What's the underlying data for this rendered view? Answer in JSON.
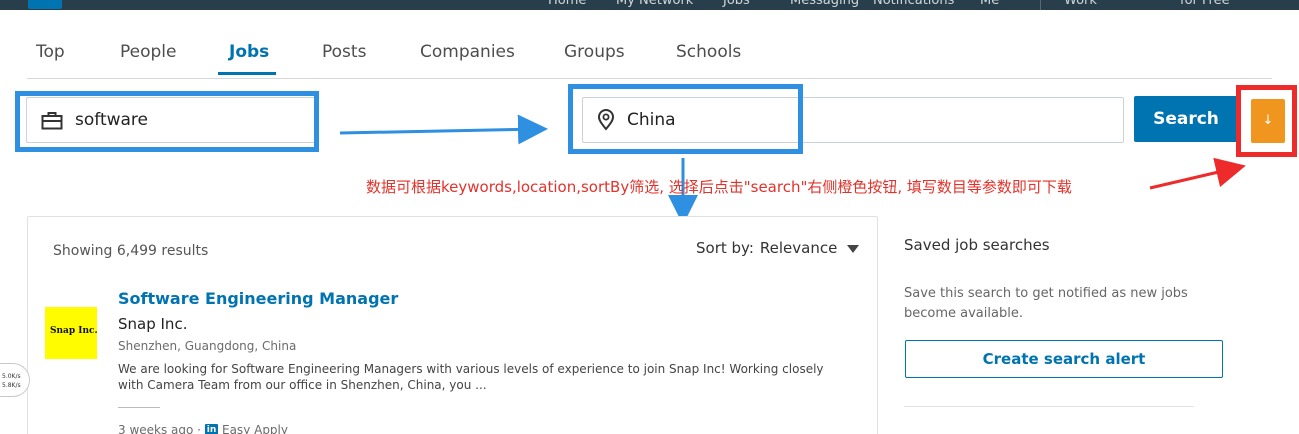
{
  "topnav": {
    "items": [
      "Home",
      "My Network",
      "Jobs",
      "Messaging",
      "Notifications",
      "Me",
      "Work",
      "for Free"
    ]
  },
  "tabs": [
    "Top",
    "People",
    "Jobs",
    "Posts",
    "Companies",
    "Groups",
    "Schools"
  ],
  "active_tab": "Jobs",
  "search": {
    "keywords_value": "software",
    "location_value": "China",
    "button_label": "Search",
    "download_icon": "↓"
  },
  "annotation": {
    "text": "数据可根据keywords,location,sortBy筛选, 选择后点击\"search\"右侧橙色按钮, 填写数目等参数即可下载"
  },
  "results": {
    "count_text": "Showing 6,499 results",
    "sort_label": "Sort by:",
    "sort_value": "Relevance"
  },
  "job": {
    "logo_text": "Snap Inc.",
    "title": "Software Engineering Manager",
    "company": "Snap Inc.",
    "location": "Shenzhen, Guangdong, China",
    "description": "We are looking for Software Engineering Managers with various levels of experience to join Snap Inc! Working closely with Camera Team from our office in Shenzhen, China, you ...",
    "posted": "3 weeks ago ·",
    "apply_badge": "in",
    "apply_label": "Easy Apply"
  },
  "saved": {
    "title": "Saved job searches",
    "description": "Save this search to get notified as new jobs become available.",
    "button_label": "Create search alert"
  },
  "speed": {
    "up": "5.0K/s",
    "down": "5.8K/s"
  },
  "colors": {
    "brand": "#0073b1",
    "download": "#f0961e",
    "annotation_blue": "#2f8fe0",
    "annotation_red": "#ee2b2b"
  }
}
